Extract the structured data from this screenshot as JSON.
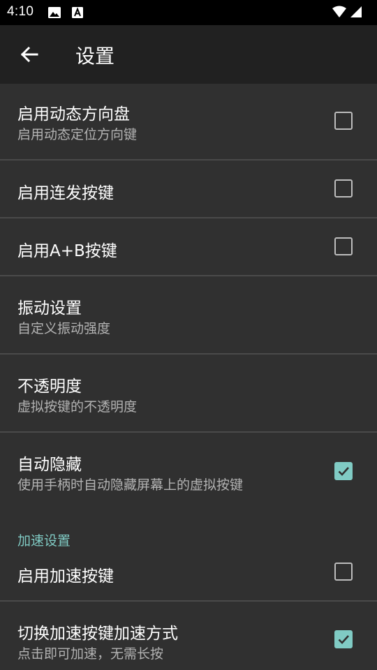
{
  "status_bar": {
    "time": "4:10",
    "icons": [
      "image-notification-icon",
      "font-notification-icon",
      "wifi-icon",
      "signal-icon"
    ]
  },
  "app_bar": {
    "title": "设置",
    "back_icon": "arrow-back-icon"
  },
  "colors": {
    "accent": "#80cbc4",
    "background": "#303030",
    "app_bar": "#212121",
    "status_bar": "#000000",
    "divider": "#4a4a4a"
  },
  "preferences": [
    {
      "title": "启用动态方向盘",
      "summary": "启用动态定位方向键",
      "checked": false
    },
    {
      "title": "启用连发按键",
      "checked": false
    },
    {
      "title": "启用A+B按键",
      "checked": false
    },
    {
      "title": "振动设置",
      "summary": "自定义振动强度"
    },
    {
      "title": "不透明度",
      "summary": "虚拟按键的不透明度"
    },
    {
      "title": "自动隐藏",
      "summary": "使用手柄时自动隐藏屏幕上的虚拟按键",
      "checked": true
    }
  ],
  "category": {
    "title": "加速设置",
    "items": [
      {
        "title": "启用加速按键",
        "checked": false
      },
      {
        "title": "切换加速按键加速方式",
        "summary": "点击即可加速，无需长按",
        "checked": true
      }
    ]
  }
}
